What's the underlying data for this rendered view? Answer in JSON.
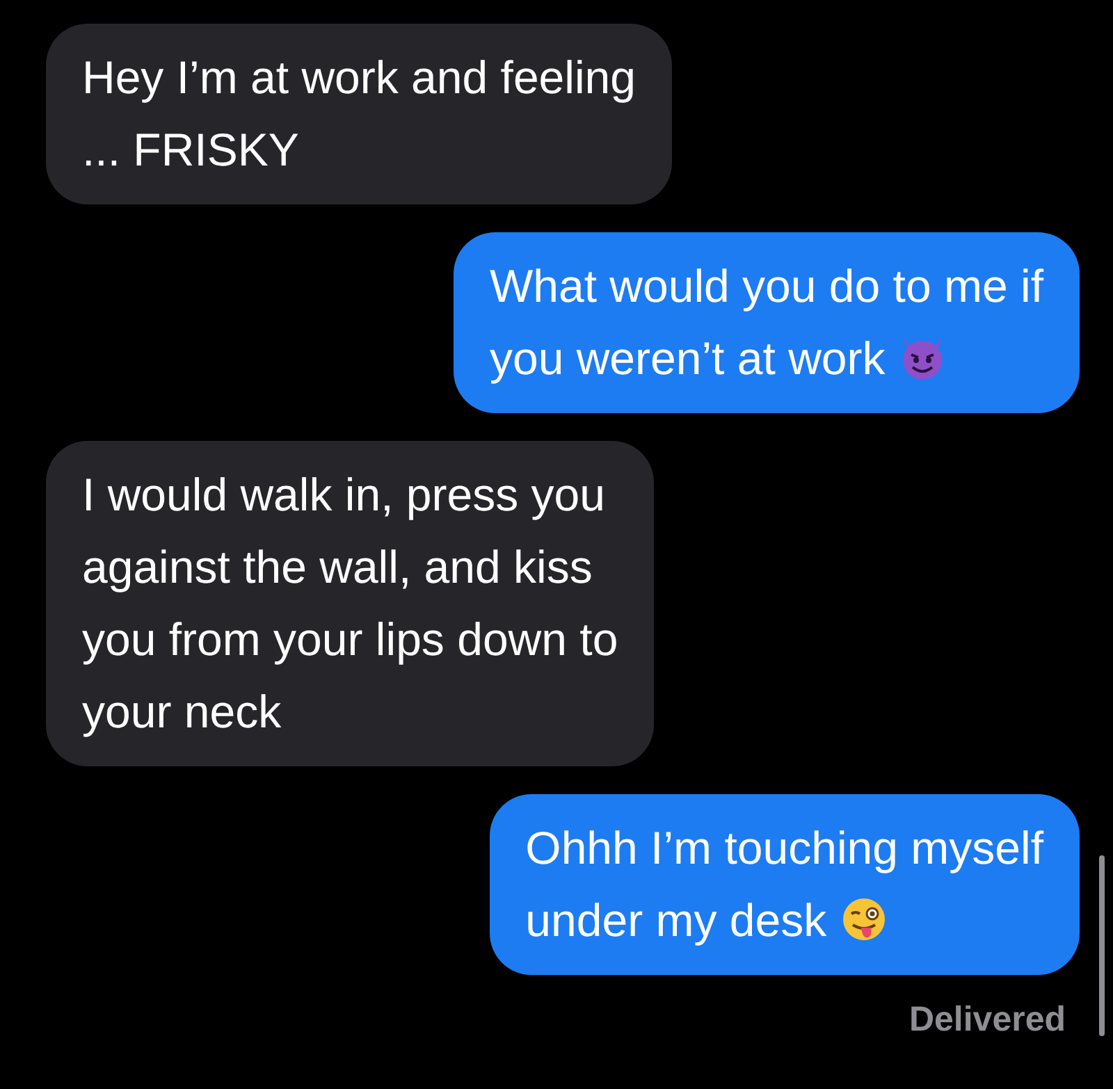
{
  "messages": [
    {
      "kind": "received",
      "text": "Hey I’m at work and feeling\n... FRISKY"
    },
    {
      "kind": "sent",
      "text": "What would you do to me if\nyou weren’t at work",
      "emoji": {
        "kind": "devil"
      }
    },
    {
      "kind": "received",
      "text": "I would walk in, press you\nagainst the wall, and kiss\nyou from your lips down to\nyour neck"
    },
    {
      "kind": "sent",
      "text": "Ohhh I’m touching myself\nunder my desk",
      "emoji": {
        "kind": "winking"
      }
    }
  ],
  "status": "Delivered"
}
